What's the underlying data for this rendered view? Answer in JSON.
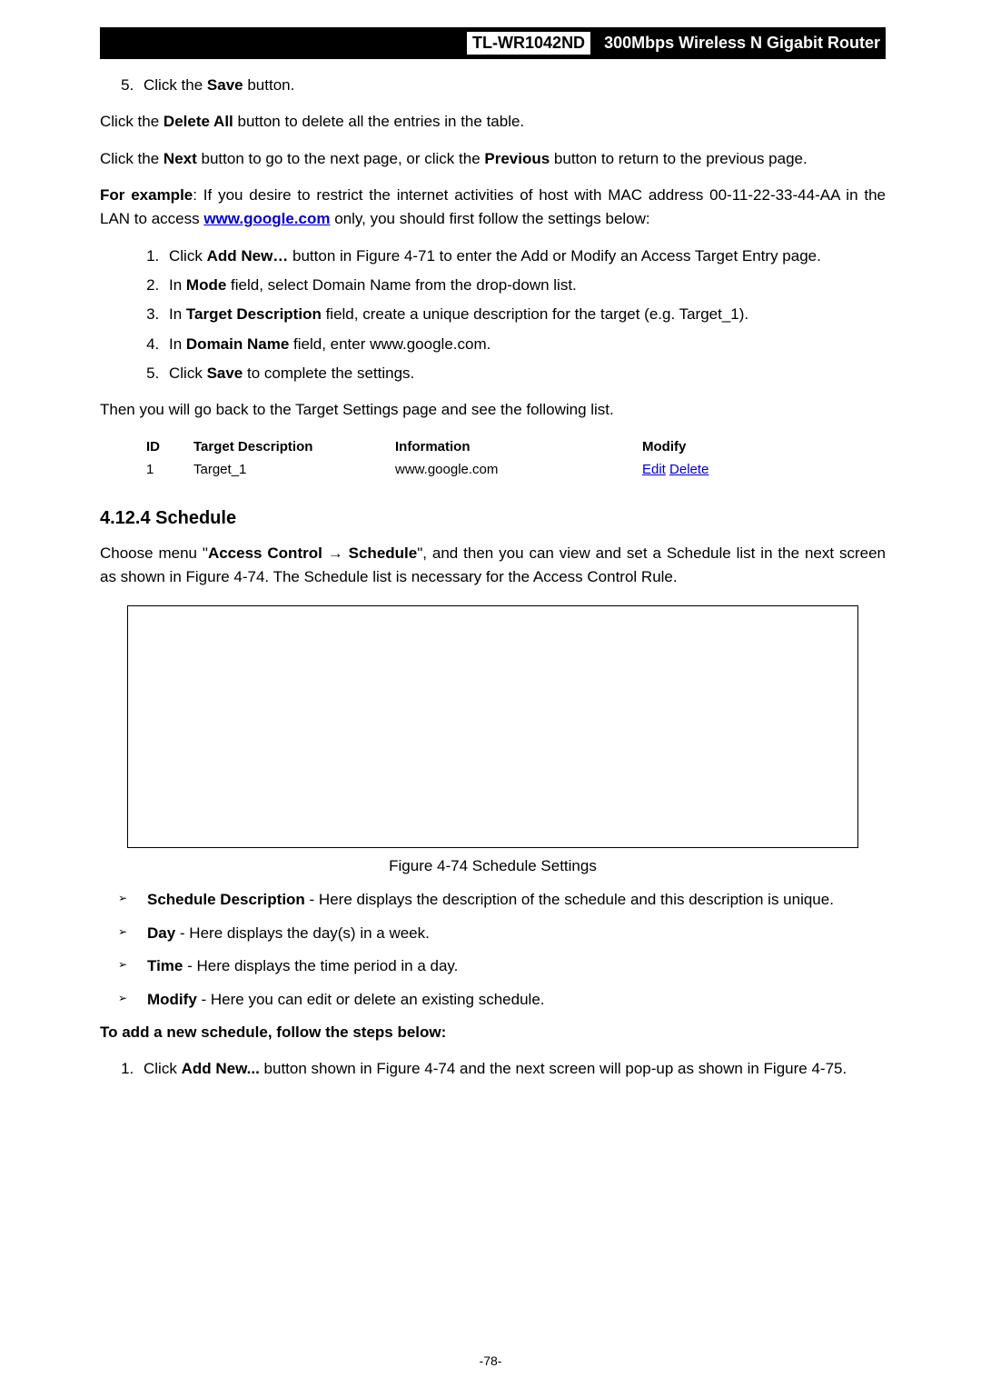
{
  "header": {
    "model": "TL-WR1042ND",
    "product": "300Mbps Wireless N Gigabit Router"
  },
  "step5": "Click the ",
  "step5b": "Save",
  "step5c": " button.",
  "p_delete_a": "Click the ",
  "p_delete_b": "Delete All",
  "p_delete_c": " button to delete all the entries in the table.",
  "p_next_a": "Click the ",
  "p_next_b": "Next",
  "p_next_c": " button to go to the next page, or click the ",
  "p_next_d": "Previous",
  "p_next_e": " button to return to the previous page.",
  "ex_a": "For example",
  "ex_b": ": If you desire to restrict the internet activities of host with MAC address 00-11-22-33-44-AA in the LAN to access ",
  "ex_link": "www.google.com",
  "ex_c": " only, you should first follow the settings below:",
  "steps_inner": {
    "s1a": "Click ",
    "s1b": "Add New…",
    "s1c": " button in Figure 4-71 to enter the Add or Modify an Access Target Entry page.",
    "s2a": "In ",
    "s2b": "Mode",
    "s2c": " field, select Domain Name from the drop-down list.",
    "s3a": "In ",
    "s3b": "Target Description",
    "s3c": " field, create a unique description for the target (e.g. Target_1).",
    "s4a": "In ",
    "s4b": "Domain Name",
    "s4c": " field, enter www.google.com.",
    "s5a": "Click ",
    "s5b": "Save",
    "s5c": " to complete the settings."
  },
  "then_back": "Then you will go back to the Target Settings page and see the following list.",
  "table": {
    "h_id": "ID",
    "h_td": "Target Description",
    "h_info": "Information",
    "h_mod": "Modify",
    "row": {
      "id": "1",
      "td": "Target_1",
      "info": "www.google.com",
      "edit": "Edit",
      "delete": "Delete"
    }
  },
  "h3_schedule": "4.12.4  Schedule",
  "sched_p_a": "Choose menu \"",
  "sched_p_b": "Access Control",
  "sched_p_arr": "  →  ",
  "sched_p_c": "Schedule",
  "sched_p_d": "\", and then you can view and set a Schedule list in the next screen as shown in Figure 4-74. The Schedule list is necessary for the Access Control Rule.",
  "fig_caption": "Figure 4-74   Schedule Settings",
  "bullets": {
    "b1a": "Schedule Description",
    "b1b": " - Here displays the description of the schedule and this description is unique.",
    "b2a": "Day",
    "b2b": " - Here displays the day(s) in a week.",
    "b3a": "Time",
    "b3b": " - Here displays the time period in a day.",
    "b4a": "Modify",
    "b4b": " - Here you can edit or delete an existing schedule."
  },
  "to_add": "To add a new schedule, follow the steps below:",
  "add_1a": "Click ",
  "add_1b": "Add New...",
  "add_1c": " button shown in Figure 4-74 and the next screen will pop-up as shown in Figure 4-75.",
  "page_no": "-78-"
}
